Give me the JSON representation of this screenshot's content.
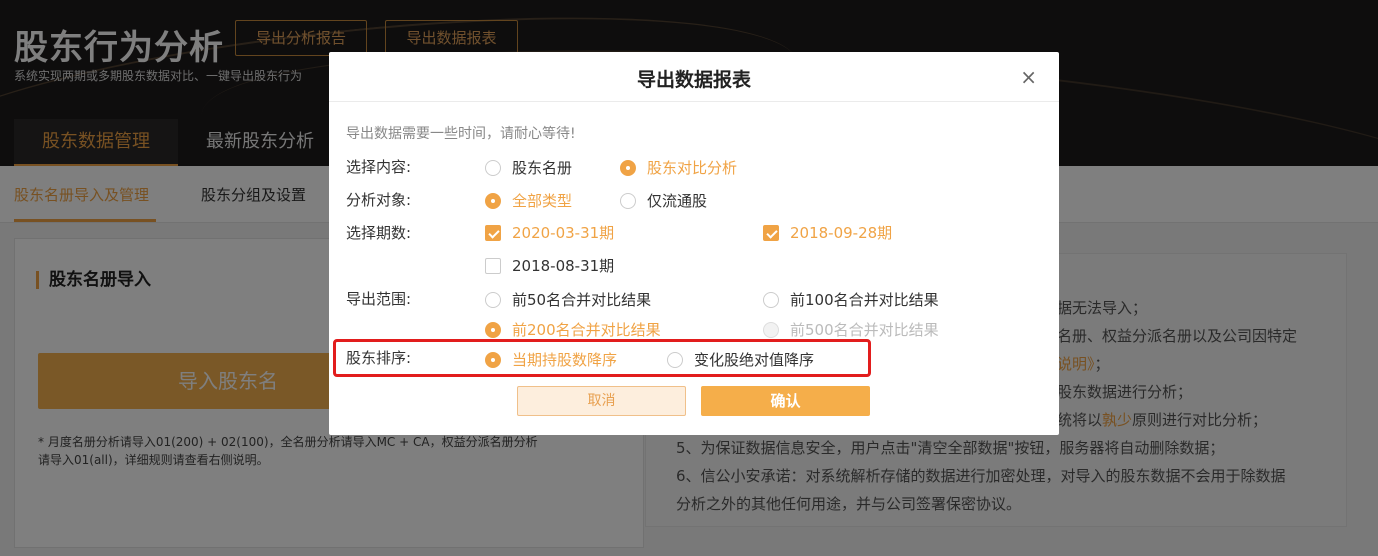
{
  "header": {
    "title": "股东行为分析",
    "subtitle": "系统实现两期或多期股东数据对比、一键导出股东行为",
    "export_report_label": "导出分析报告",
    "export_data_label": "导出数据报表"
  },
  "main_tabs": [
    "股东数据管理",
    "最新股东分析"
  ],
  "sub_nav": [
    "股东名册导入及管理",
    "股东分组及设置"
  ],
  "left_panel": {
    "title": "股东名册导入",
    "import_button": "导入股东名",
    "note": "* 月度名册分析请导入01(200) + 02(100)，全名册分析请导入MC + CA，权益分派名册分析请导入01(all)，详细规则请查看右侧说明。"
  },
  "right_panel": {
    "line1": "据无法导入；",
    "line2": "名册、权益分派名册以及公司因特定",
    "line3_link": "说明》",
    "line3_tail": "；",
    "line4": "股东数据进行分析；",
    "line5_pre": "统将以",
    "line5_hl": "孰少",
    "line5_post": "原则进行对比分析；",
    "line6": "5、为保证数据信息安全，用户点击\"清空全部数据\"按钮，服务器将自动删除数据；",
    "line7": "6、信公小安承诺：对系统解析存储的数据进行加密处理，对导入的股东数据不会用于除数据",
    "line8": "分析之外的其他任何用途，并与公司签署保密协议。"
  },
  "modal": {
    "title": "导出数据报表",
    "close_icon": "×",
    "hint": "导出数据需要一些时间，请耐心等待!",
    "labels": {
      "content": "选择内容:",
      "target": "分析对象:",
      "periods": "选择期数:",
      "range": "导出范围:",
      "sort": "股东排序:"
    },
    "content_options": [
      {
        "label": "股东名册",
        "selected": false
      },
      {
        "label": "股东对比分析",
        "selected": true
      }
    ],
    "target_options": [
      {
        "label": "全部类型",
        "selected": true
      },
      {
        "label": "仅流通股",
        "selected": false
      }
    ],
    "period_options": [
      {
        "label": "2020-03-31期",
        "checked": true
      },
      {
        "label": "2018-09-28期",
        "checked": true
      },
      {
        "label": "2018-08-31期",
        "checked": false
      }
    ],
    "range_options": [
      {
        "label": "前50名合并对比结果",
        "selected": false,
        "disabled": false
      },
      {
        "label": "前100名合并对比结果",
        "selected": false,
        "disabled": false
      },
      {
        "label": "前200名合并对比结果",
        "selected": true,
        "disabled": false
      },
      {
        "label": "前500名合并对比结果",
        "selected": false,
        "disabled": true
      }
    ],
    "sort_options": [
      {
        "label": "当期持股数降序",
        "selected": true
      },
      {
        "label": "变化股绝对值降序",
        "selected": false
      }
    ],
    "cancel_label": "取消",
    "ok_label": "确认"
  },
  "colors": {
    "accent": "#f0a345",
    "highlight_box": "#e21d1d"
  }
}
